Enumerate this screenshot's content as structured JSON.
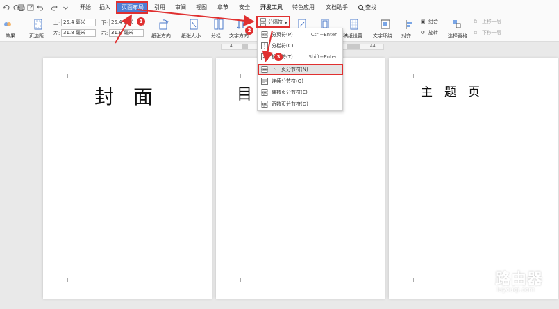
{
  "menu": {
    "tabs": [
      {
        "label": "开始",
        "bold": false
      },
      {
        "label": "插入",
        "bold": false
      },
      {
        "label": "页面布局",
        "bold": false,
        "active": true
      },
      {
        "label": "引用",
        "bold": false
      },
      {
        "label": "审阅",
        "bold": false
      },
      {
        "label": "视图",
        "bold": false
      },
      {
        "label": "章节",
        "bold": false
      },
      {
        "label": "安全",
        "bold": false
      },
      {
        "label": "开发工具",
        "bold": true
      },
      {
        "label": "特色应用",
        "bold": false
      },
      {
        "label": "文档助手",
        "bold": false
      }
    ],
    "search_label": "查找"
  },
  "ribbon": {
    "effects_label": "效果",
    "margins_label": "页边距",
    "margin_top_label": "上:",
    "margin_top_value": "25.4 毫米",
    "margin_bottom_label": "下:",
    "margin_bottom_value": "25.4 毫米",
    "margin_left_label": "左:",
    "margin_left_value": "31.8 毫米",
    "margin_right_label": "右:",
    "margin_right_value": "31.8 毫米",
    "orientation_label": "纸张方向",
    "size_label": "纸张大小",
    "columns_label": "分栏",
    "text_direction_label": "文字方向",
    "breaks_label": "分隔符",
    "manuscript_label": "稿纸设置",
    "wrap_label": "文字环绕",
    "align_label": "对齐",
    "group_label": "组合",
    "rotate_label": "旋转",
    "selection_pane_label": "选择窗格",
    "bring_forward_label": "上移一层",
    "send_backward_label": "下移一层"
  },
  "ruler": {
    "left_num": "4",
    "right_num": "44"
  },
  "dropdown": {
    "items": [
      {
        "label": "分页符(P)",
        "shortcut": "Ctrl+Enter",
        "icon": "page-break-icon"
      },
      {
        "label": "分栏符(C)",
        "shortcut": "",
        "icon": "column-break-icon"
      },
      {
        "label": "换行符(T)",
        "shortcut": "Shift+Enter",
        "icon": "line-break-icon"
      },
      {
        "label": "下一页分节符(N)",
        "shortcut": "",
        "icon": "next-page-section-break-icon",
        "highlighted": true
      },
      {
        "label": "连续分节符(O)",
        "shortcut": "",
        "icon": "continuous-section-break-icon"
      },
      {
        "label": "偶数页分节符(E)",
        "shortcut": "",
        "icon": "even-page-section-break-icon"
      },
      {
        "label": "奇数页分节符(D)",
        "shortcut": "",
        "icon": "odd-page-section-break-icon"
      }
    ]
  },
  "pages": [
    {
      "title": "封　面"
    },
    {
      "title": "目　　页"
    },
    {
      "title": "主　题　页"
    }
  ],
  "annotations": {
    "badges": [
      "1",
      "2",
      "3"
    ],
    "color": "#e03030"
  },
  "watermark": {
    "title": "路由器",
    "subtitle": "luyouqi.com"
  },
  "colors": {
    "accent": "#4e7ed4",
    "annotation": "#e03030"
  }
}
